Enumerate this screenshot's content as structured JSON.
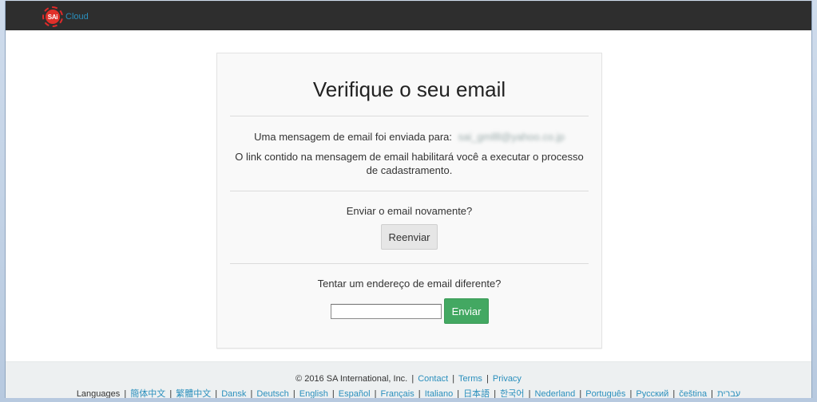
{
  "navbar": {
    "logo_text": "SAi",
    "brand_text": "Cloud",
    "logo_icon": "sai-logo-icon"
  },
  "card": {
    "title": "Verifique o seu email",
    "sent_label": "Uma mensagem de email foi enviada para:",
    "sent_email": "sai_gmllll@yahoo.co.jp",
    "info_text": "O link contido na mensagem de email habilitará você a executar o processo de cadastramento.",
    "resend_question": "Enviar o email novamente?",
    "resend_button": "Reenviar",
    "other_question": "Tentar um endereço de email diferente?",
    "email_input_value": "",
    "email_input_placeholder": "",
    "send_button": "Enviar"
  },
  "footer": {
    "copyright": "© 2016 SA International, Inc.",
    "links": [
      "Contact",
      "Terms",
      "Privacy"
    ],
    "languages_label": "Languages",
    "languages": [
      "簡体中文",
      "繁體中文",
      "Dansk",
      "Deutsch",
      "English",
      "Español",
      "Français",
      "Italiano",
      "日本語",
      "한국어",
      "Nederland",
      "Português",
      "Русский",
      "čeština",
      "עברית"
    ],
    "separator": "|"
  },
  "colors": {
    "navbar_bg": "#2e2e2e",
    "brand_blue": "#2a8fbd",
    "logo_red": "#e0302a",
    "send_green": "#43a862",
    "card_bg": "#f9f9f9",
    "footer_bg": "#edf0f1"
  }
}
